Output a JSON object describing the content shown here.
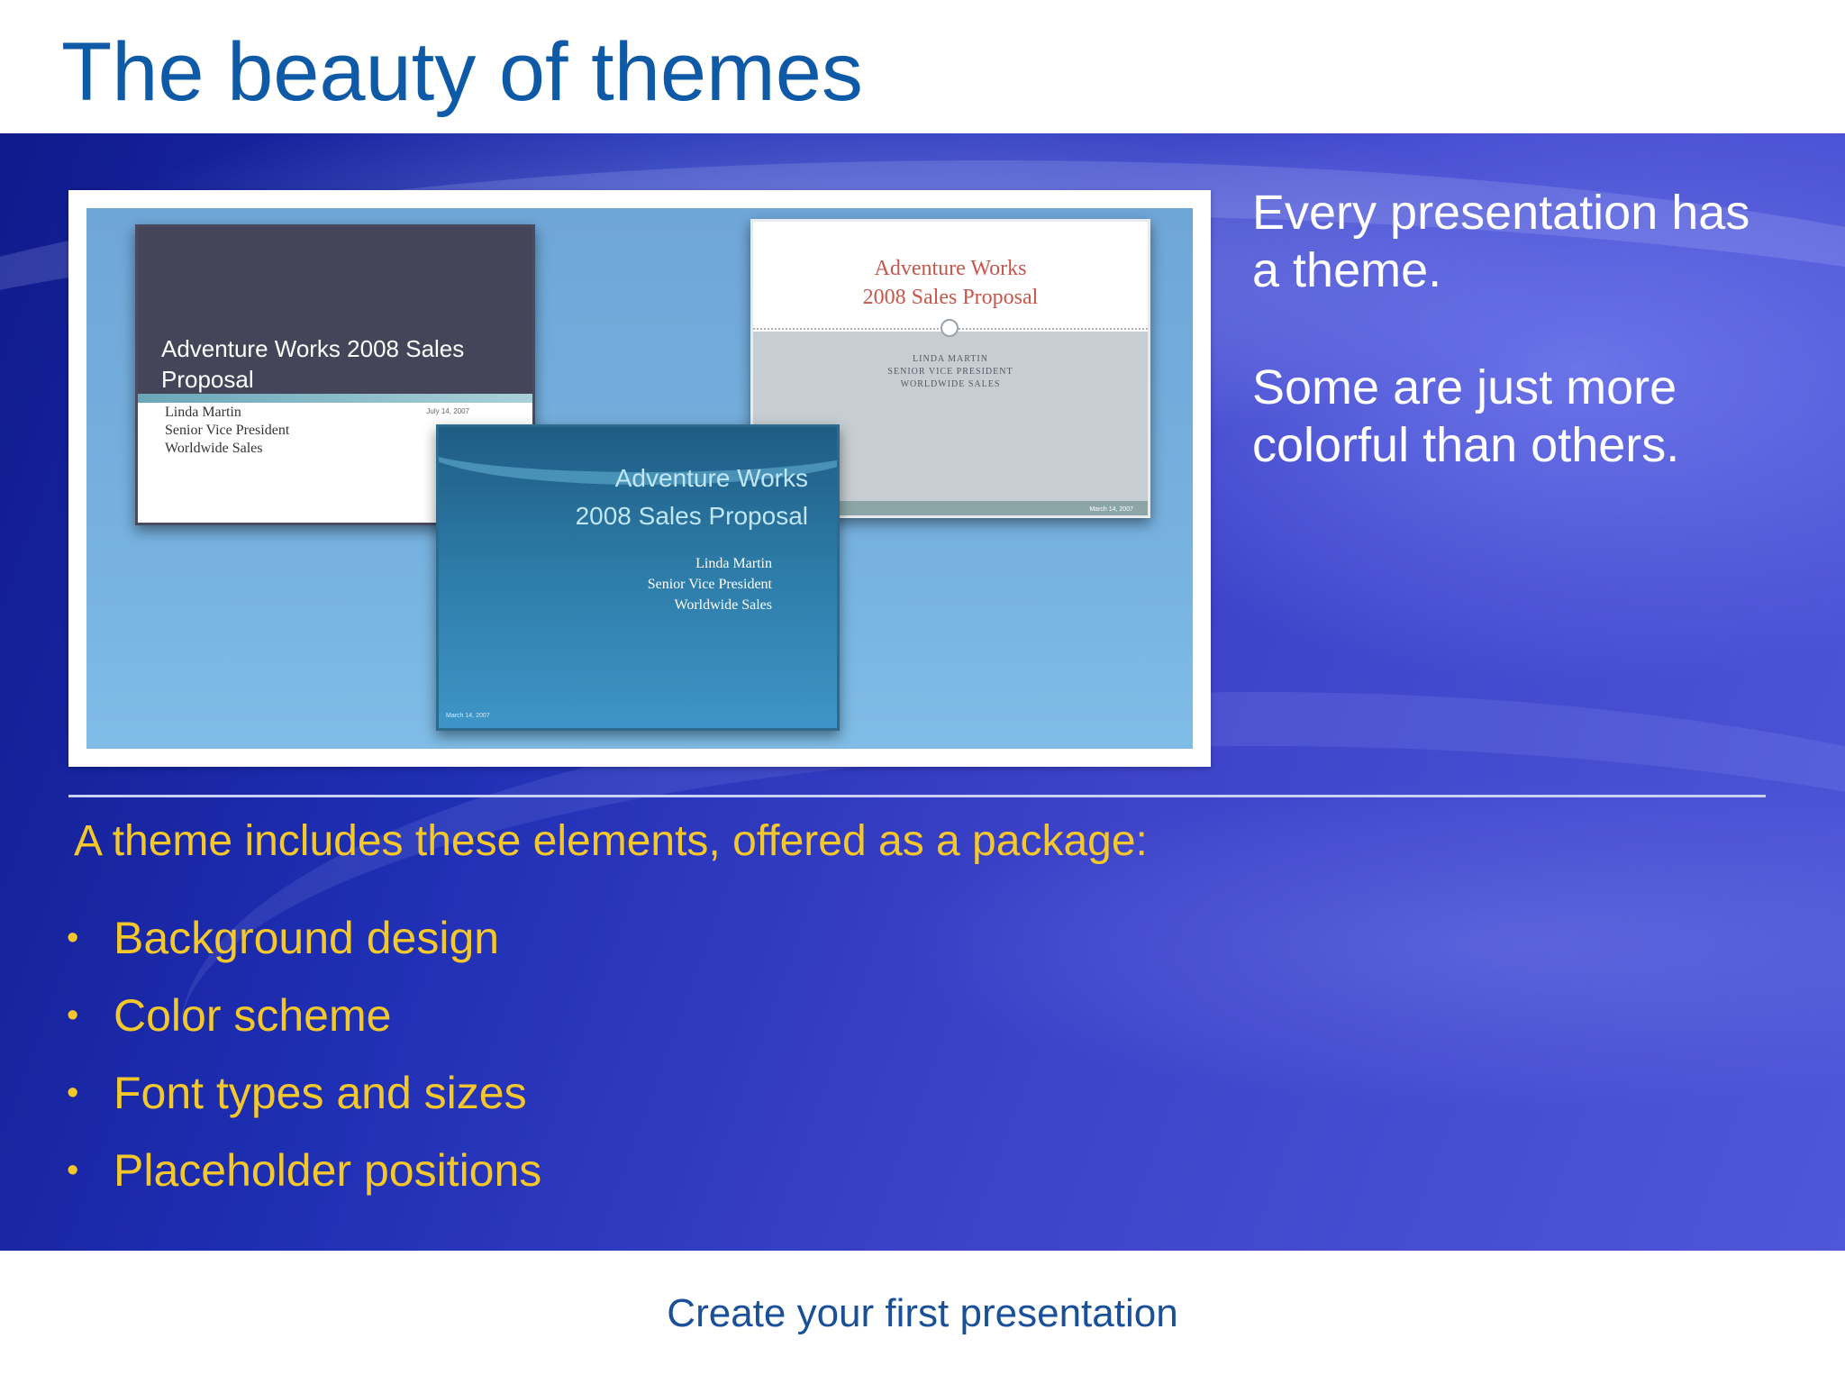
{
  "slide": {
    "title": "The beauty of themes",
    "title_color": "#0e5aa7",
    "footer": "Create your first presentation",
    "footer_color": "#1a4f99"
  },
  "thumbnails": [
    {
      "title": "Adventure Works 2008 Sales Proposal",
      "subtitle": "Linda Martin\nSenior Vice President\nWorldwide Sales",
      "date": "July 14, 2007"
    },
    {
      "title": "Adventure Works\n2008 Sales Proposal",
      "subtitle": "LINDA MARTIN\nSENIOR VICE PRESIDENT\nWORLDWIDE SALES",
      "date": "March 14, 2007"
    },
    {
      "title": "Adventure Works\n2008 Sales Proposal",
      "subtitle": "Linda Martin\nSenior Vice President\nWorldwide Sales",
      "date": "March 14, 2007"
    }
  ],
  "side_text": {
    "para1": "Every presentation has a theme.",
    "para2": "Some are just more colorful than others."
  },
  "elements_intro": "A theme includes these elements, offered as a package:",
  "bullet_glyph": "•",
  "bullets": [
    "Background design",
    "Color scheme",
    "Font types and sizes",
    "Placeholder positions"
  ],
  "colors": {
    "bullet_text": "#f4c82a",
    "band": "#2430b8"
  }
}
